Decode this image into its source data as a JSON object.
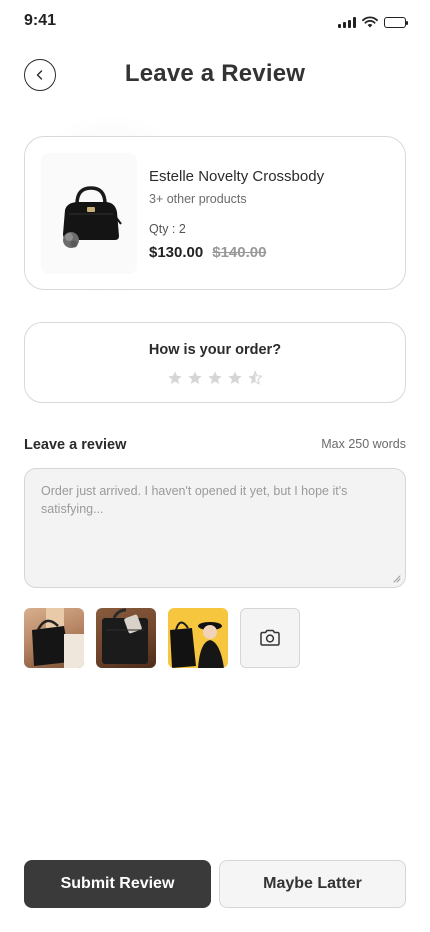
{
  "status_bar": {
    "time": "9:41",
    "icons": [
      "signal-icon",
      "wifi-icon",
      "battery-icon"
    ]
  },
  "header": {
    "back_icon": "chevron-left-icon",
    "title": "Leave a Review"
  },
  "product": {
    "name": "Estelle Novelty Crossbody",
    "subtitle": "3+ other products",
    "qty": "Qty : 2",
    "price": "$130.00",
    "old_price": "$140.00",
    "image_icon": "handbag-image"
  },
  "rating": {
    "question": "How is your order?",
    "max_stars": 5,
    "value": 0,
    "star_color": "#d6d6d6"
  },
  "review": {
    "label": "Leave a review",
    "limit": "Max 250 words",
    "text": "Order just arrived. I haven't opened it yet, but I hope it's satisfying...",
    "photos": [
      "photo-woman-with-bag",
      "photo-black-tote",
      "photo-woman-yellow-bg"
    ],
    "add_photo_icon": "camera-icon"
  },
  "actions": {
    "submit_label": "Submit Review",
    "later_label": "Maybe Latter"
  },
  "colors": {
    "primary": "#3a3a3a",
    "border": "#d9d9d9",
    "field_bg": "#f3f3f3",
    "muted_text": "#999999"
  }
}
